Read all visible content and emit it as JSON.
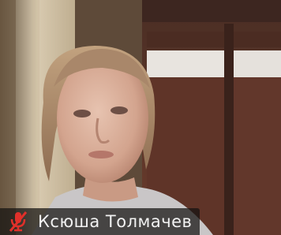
{
  "participant": {
    "name": "Ксюша Толмачев",
    "audio_muted": true,
    "mic_icon": "muted-mic-icon"
  },
  "colors": {
    "mute_red": "#e0302a",
    "nameplate_text": "#f2f2f2"
  }
}
